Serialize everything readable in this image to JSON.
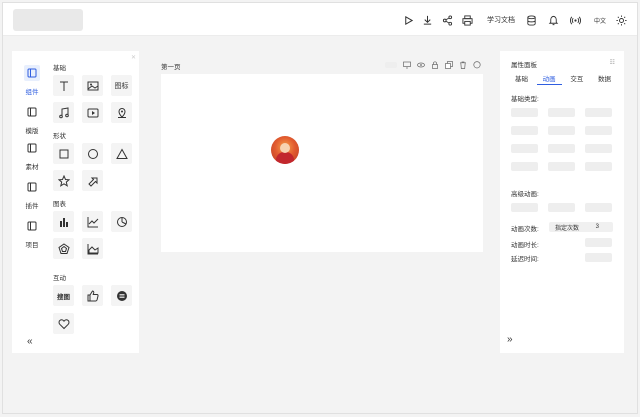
{
  "toolbar": {
    "study_docs": "学习文档",
    "language": "中文",
    "icons": [
      "play-icon",
      "download-icon",
      "share-icon",
      "print-icon",
      "database-icon",
      "bell-icon",
      "broadcast-icon",
      "sun-icon"
    ]
  },
  "left_nav": [
    {
      "label": "组件",
      "icon": "components-icon",
      "active": true
    },
    {
      "label": "模版",
      "icon": "template-icon",
      "active": false
    },
    {
      "label": "素材",
      "icon": "material-icon",
      "active": false
    },
    {
      "label": "插件",
      "icon": "plugin-icon",
      "active": false
    },
    {
      "label": "项目",
      "icon": "project-icon",
      "active": false
    }
  ],
  "library": {
    "basic": {
      "title": "基础",
      "items": [
        "text-icon",
        "image-icon",
        "图标",
        "music-icon",
        "video-icon",
        "location-icon"
      ],
      "icon_tile_label": "图标"
    },
    "shapes": {
      "title": "形状",
      "items": [
        "rectangle-icon",
        "circle-icon",
        "triangle-icon",
        "star-icon",
        "arrow-icon"
      ]
    },
    "charts": {
      "title": "图表",
      "items": [
        "bar-chart-icon",
        "line-chart-icon",
        "pie-chart-icon",
        "radar-chart-icon",
        "area-chart-icon"
      ]
    },
    "interactive": {
      "title": "互动",
      "items": [
        "搜图",
        "thumbs-up-icon",
        "vote-icon",
        "heart-icon"
      ],
      "search_tile_label": "搜图"
    }
  },
  "canvas": {
    "page_title": "第一页",
    "tools": [
      "screen-icon",
      "eye-icon",
      "lock-icon",
      "copy-icon",
      "trash-icon",
      "comment-icon"
    ]
  },
  "properties": {
    "title": "属性面板",
    "tabs": [
      {
        "label": "基础",
        "active": false
      },
      {
        "label": "动画",
        "active": true
      },
      {
        "label": "交互",
        "active": false
      },
      {
        "label": "数据",
        "active": false
      }
    ],
    "basic_animation_label": "基础类型:",
    "advanced_animation_label": "高级动画:",
    "animation_count_label": "动画次数:",
    "animation_count_mode": "指定次数",
    "animation_count_value": "3",
    "animation_duration_label": "动画时长:",
    "delay_label": "延迟时间:"
  },
  "colors": {
    "accent": "#2f5ee0",
    "tile_bg": "#f4f4f4",
    "panel_bg": "#ffffff",
    "page_bg": "#f3f3f3"
  }
}
